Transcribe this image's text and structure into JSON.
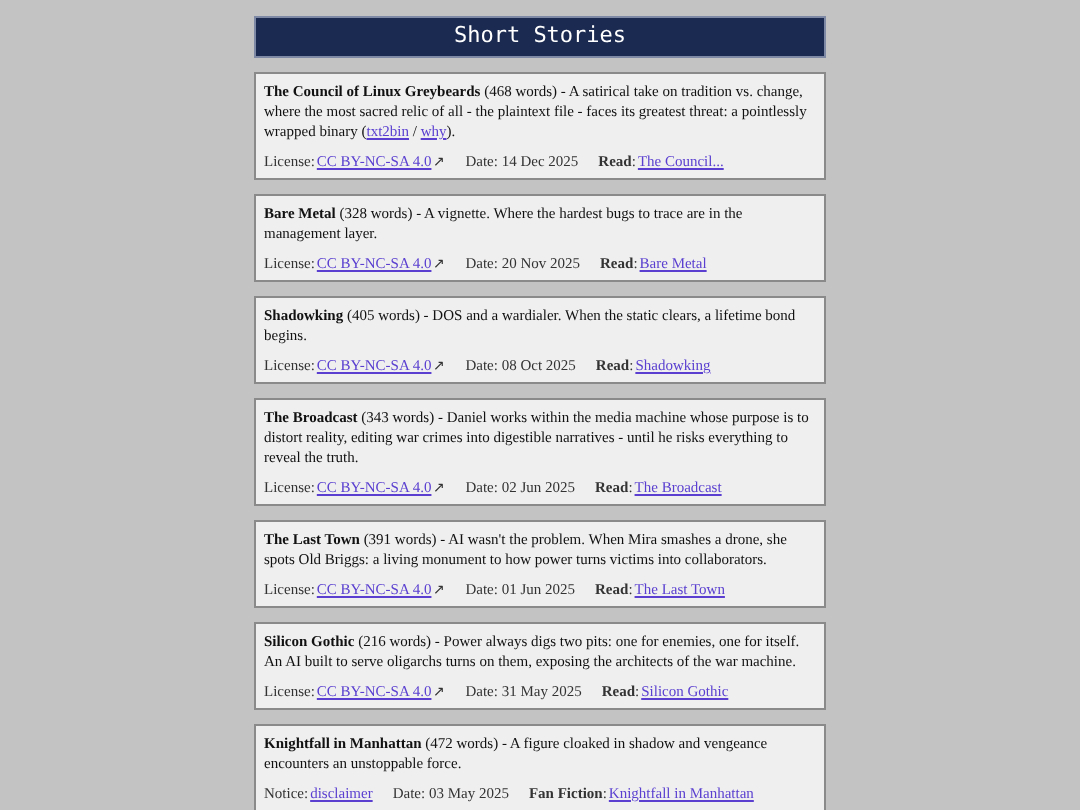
{
  "header": {
    "title": "Short Stories"
  },
  "stories": [
    {
      "summary": [
        {
          "kind": "text",
          "text": "**The Council of Linux Greybeards** (468 words) - A satirical take on tradition vs. change, where the most sacred relic of all - the plaintext file - faces its greatest threat: a pointlessly wrapped binary ("
        },
        {
          "kind": "link",
          "text": "txt2bin"
        },
        {
          "kind": "text",
          "text": " / "
        },
        {
          "kind": "link",
          "text": "why"
        },
        {
          "kind": "text",
          "text": ")."
        }
      ],
      "meta": [
        {
          "kind": "link",
          "label": "License:",
          "link": "CC BY-NC-SA 4.0",
          "suffix": "↗"
        },
        {
          "kind": "text",
          "text": "Date: 14 Dec 2025"
        },
        {
          "kind": "link",
          "label": "**Read**:",
          "link": "The Council..."
        }
      ]
    },
    {
      "summary": [
        {
          "kind": "text",
          "text": "**Bare Metal** (328 words) - A vignette. Where the hardest bugs to trace are in the management layer."
        }
      ],
      "meta": [
        {
          "kind": "link",
          "label": "License:",
          "link": "CC BY-NC-SA 4.0",
          "suffix": "↗"
        },
        {
          "kind": "text",
          "text": "Date: 20 Nov 2025"
        },
        {
          "kind": "link",
          "label": "**Read**:",
          "link": "Bare Metal"
        }
      ]
    },
    {
      "summary": [
        {
          "kind": "text",
          "text": "**Shadowking** (405 words) - DOS and a wardialer. When the static clears, a lifetime bond begins."
        }
      ],
      "meta": [
        {
          "kind": "link",
          "label": "License:",
          "link": "CC BY-NC-SA 4.0",
          "suffix": "↗"
        },
        {
          "kind": "text",
          "text": "Date: 08 Oct 2025"
        },
        {
          "kind": "link",
          "label": "**Read**:",
          "link": "Shadowking"
        }
      ]
    },
    {
      "summary": [
        {
          "kind": "text",
          "text": "**The Broadcast** (343 words) - Daniel works within the media machine whose purpose is to distort reality, editing war crimes into digestible narratives - until he risks everything to reveal the truth."
        }
      ],
      "meta": [
        {
          "kind": "link",
          "label": "License:",
          "link": "CC BY-NC-SA 4.0",
          "suffix": "↗"
        },
        {
          "kind": "text",
          "text": "Date: 02 Jun 2025"
        },
        {
          "kind": "link",
          "label": "**Read**:",
          "link": "The Broadcast"
        }
      ]
    },
    {
      "summary": [
        {
          "kind": "text",
          "text": "**The Last Town** (391 words) - AI wasn't the problem. When Mira smashes a drone, she spots Old Briggs: a living monument to how power turns victims into collaborators."
        }
      ],
      "meta": [
        {
          "kind": "link",
          "label": "License:",
          "link": "CC BY-NC-SA 4.0",
          "suffix": "↗"
        },
        {
          "kind": "text",
          "text": "Date: 01 Jun 2025"
        },
        {
          "kind": "link",
          "label": "**Read**:",
          "link": "The Last Town"
        }
      ]
    },
    {
      "summary": [
        {
          "kind": "text",
          "text": "**Silicon Gothic** (216 words) - Power always digs two pits: one for enemies, one for itself. An AI built to serve oligarchs turns on them, exposing the architects of the war machine."
        }
      ],
      "meta": [
        {
          "kind": "link",
          "label": "License:",
          "link": "CC BY-NC-SA 4.0",
          "suffix": "↗"
        },
        {
          "kind": "text",
          "text": "Date: 31 May 2025"
        },
        {
          "kind": "link",
          "label": "**Read**:",
          "link": "Silicon Gothic"
        }
      ]
    },
    {
      "summary": [
        {
          "kind": "text",
          "text": "**Knightfall in Manhattan** (472 words) - A figure cloaked in shadow and vengeance encounters an unstoppable force."
        }
      ],
      "meta": [
        {
          "kind": "link",
          "label": "Notice:",
          "link": "disclaimer"
        },
        {
          "kind": "text",
          "text": "Date: 03 May 2025"
        },
        {
          "kind": "link",
          "label": "**Fan Fiction**:",
          "link": "Knightfall in Manhattan"
        }
      ]
    }
  ]
}
